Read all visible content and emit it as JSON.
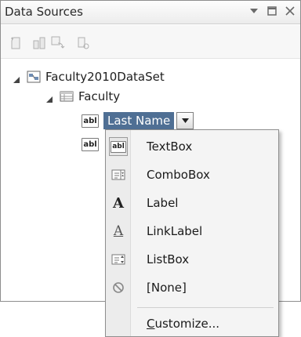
{
  "panel": {
    "title": "Data Sources"
  },
  "tree": {
    "dataset_label": "Faculty2010DataSet",
    "table_label": "Faculty",
    "field_label": "Last Name",
    "field_icon_text": "abl",
    "second_field_icon_text": "abl"
  },
  "menu": {
    "items": [
      {
        "label": "TextBox",
        "icon": "textbox-icon",
        "icon_text": "abl"
      },
      {
        "label": "ComboBox",
        "icon": "combobox-icon"
      },
      {
        "label": "Label",
        "icon": "label-icon",
        "icon_text": "A"
      },
      {
        "label": "LinkLabel",
        "icon": "linklabel-icon",
        "icon_text": "A"
      },
      {
        "label": "ListBox",
        "icon": "listbox-icon"
      },
      {
        "label": "[None]",
        "icon": "none-icon"
      }
    ],
    "customize_first": "C",
    "customize_rest": "ustomize..."
  },
  "colors": {
    "selection": "#4f6f94",
    "menu_bg": "#f4f4f4"
  }
}
